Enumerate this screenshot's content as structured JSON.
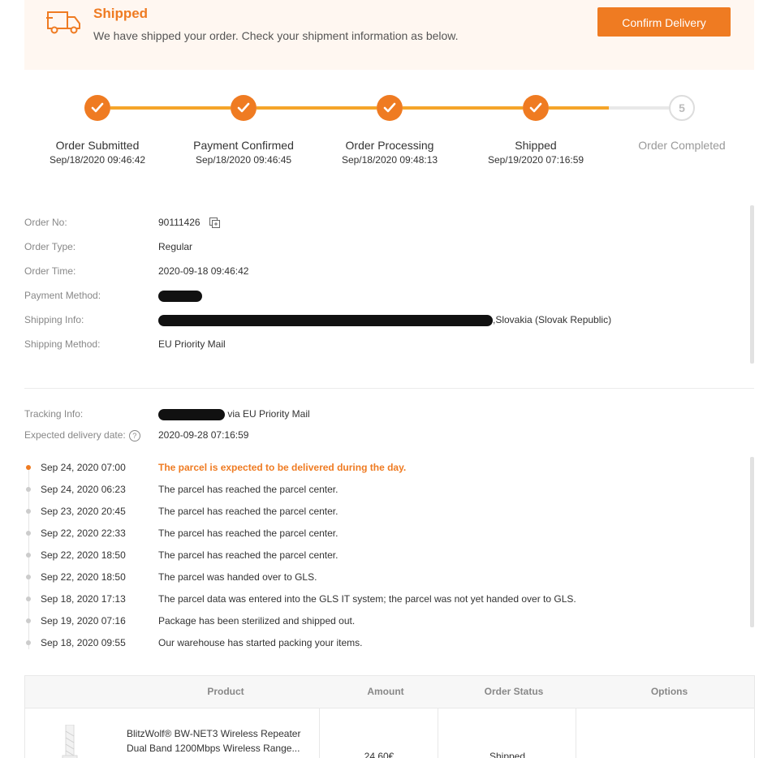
{
  "banner": {
    "title": "Shipped",
    "subtitle": "We have shipped your order. Check your shipment information as below.",
    "confirm_label": "Confirm Delivery",
    "icon": "truck-icon",
    "accent_color": "#ef7b22",
    "background_color": "#fff7f1"
  },
  "steps": [
    {
      "label": "Order Submitted",
      "date": "Sep/18/2020 09:46:42",
      "status": "done"
    },
    {
      "label": "Payment Confirmed",
      "date": "Sep/18/2020 09:46:45",
      "status": "done"
    },
    {
      "label": "Order Processing",
      "date": "Sep/18/2020 09:48:13",
      "status": "done"
    },
    {
      "label": "Shipped",
      "date": "Sep/19/2020 07:16:59",
      "status": "done"
    },
    {
      "label": "Order Completed",
      "date": "",
      "status": "todo",
      "number": "5"
    }
  ],
  "order_info": {
    "order_no_label": "Order No:",
    "order_no": "90111426",
    "order_type_label": "Order Type:",
    "order_type": "Regular",
    "order_time_label": "Order Time:",
    "order_time": "2020-09-18 09:46:42",
    "payment_method_label": "Payment Method:",
    "shipping_info_label": "Shipping Info:",
    "shipping_info_visible": ",Slovakia (Slovak Republic)",
    "shipping_method_label": "Shipping Method:",
    "shipping_method": "EU Priority Mail"
  },
  "tracking": {
    "tracking_info_label": "Tracking Info:",
    "tracking_via": " via EU Priority Mail",
    "expected_label": "Expected delivery date:",
    "expected_date": "2020-09-28 07:16:59",
    "events": [
      {
        "date": "Sep 24, 2020 07:00",
        "message": "The parcel is expected to be delivered during the day.",
        "active": true
      },
      {
        "date": "Sep 24, 2020 06:23",
        "message": "The parcel has reached the parcel center.",
        "active": false
      },
      {
        "date": "Sep 23, 2020 20:45",
        "message": "The parcel has reached the parcel center.",
        "active": false
      },
      {
        "date": "Sep 22, 2020 22:33",
        "message": "The parcel has reached the parcel center.",
        "active": false
      },
      {
        "date": "Sep 22, 2020 18:50",
        "message": "The parcel has reached the parcel center.",
        "active": false
      },
      {
        "date": "Sep 22, 2020 18:50",
        "message": "The parcel was handed over to GLS.",
        "active": false
      },
      {
        "date": "Sep 18, 2020 17:13",
        "message": "The parcel data was entered into the GLS IT system; the parcel was not yet handed over to GLS.",
        "active": false
      },
      {
        "date": "Sep 19, 2020 07:16",
        "message": "Package has been sterilized and shipped out.",
        "active": false
      },
      {
        "date": "Sep 18, 2020 09:55",
        "message": "Our warehouse has started packing your items.",
        "active": false
      }
    ]
  },
  "product_table": {
    "headers": [
      "Product",
      "Amount",
      "Order Status",
      "Options"
    ],
    "rows": [
      {
        "name": "BlitzWolf® BW-NET3 Wireless Repeater Dual Band 1200Mbps Wireless Range...",
        "amount": "24.60€",
        "status": "Shipped",
        "options": ""
      }
    ]
  }
}
